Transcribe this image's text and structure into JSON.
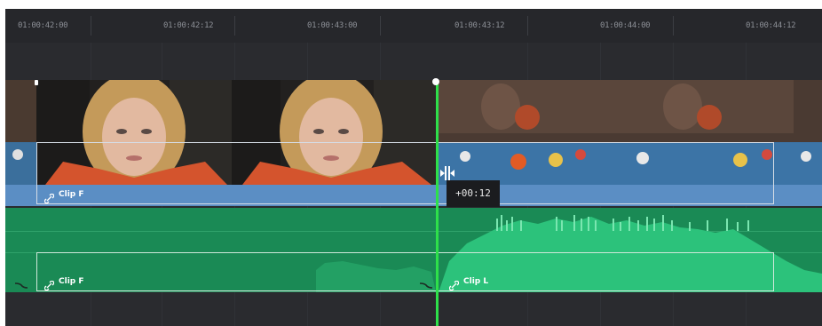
{
  "ruler": {
    "timecodes": [
      "01:00:42:00",
      "01:00:42:12",
      "01:00:43:00",
      "01:00:43:12",
      "01:00:44:00",
      "01:00:44:12"
    ]
  },
  "video_track": {
    "clips": [
      {
        "name": "Clip F"
      }
    ]
  },
  "audio_track": {
    "clips": [
      {
        "name": "Clip F"
      },
      {
        "name": "Clip L"
      }
    ]
  },
  "trim_tooltip": {
    "text": "+00:12"
  },
  "colors": {
    "playhead": "#2ee04a",
    "video_track": "#5b8ec4",
    "audio_track": "#1a8a55",
    "background": "#2a2b2f"
  },
  "icons": {
    "clip_link": "link-icon",
    "fade_curve": "fade-curve-icon",
    "trim_cursor": "roll-trim-cursor-icon"
  }
}
